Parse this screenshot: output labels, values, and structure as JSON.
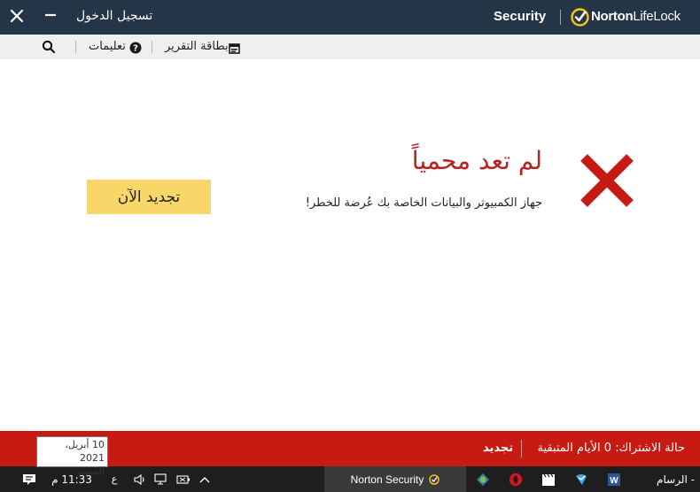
{
  "titlebar": {
    "signin_label": "تسجيل الدخول",
    "product": "Security",
    "brand_bold": "Norton",
    "brand_regular": "LifeLock"
  },
  "toolbar": {
    "help_label": "تعليمات",
    "report_label": "بطاقة التقرير"
  },
  "status": {
    "title": "لم تعد محمياً",
    "description": "جهاز الكمبيوتر والبيانات الخاصة بك عُرضة للخطر!",
    "renew_button": "تجديد الآن",
    "color": "#b9211e"
  },
  "subscription": {
    "status_text": "حالة الاشتراك:  0 الأيام المتبقية",
    "renew_link": "تجديد",
    "bar_color": "#c71a12"
  },
  "tooltip": {
    "date": "10 أبريل، 2021",
    "day": "السبت"
  },
  "taskbar": {
    "time": "11:33 م",
    "lang": "ع",
    "active_task": "Norton Security",
    "paint_label": "- الرسام",
    "apps": [
      "color-icon",
      "opera-icon",
      "video-icon",
      "shield-app-icon",
      "word-icon"
    ]
  }
}
